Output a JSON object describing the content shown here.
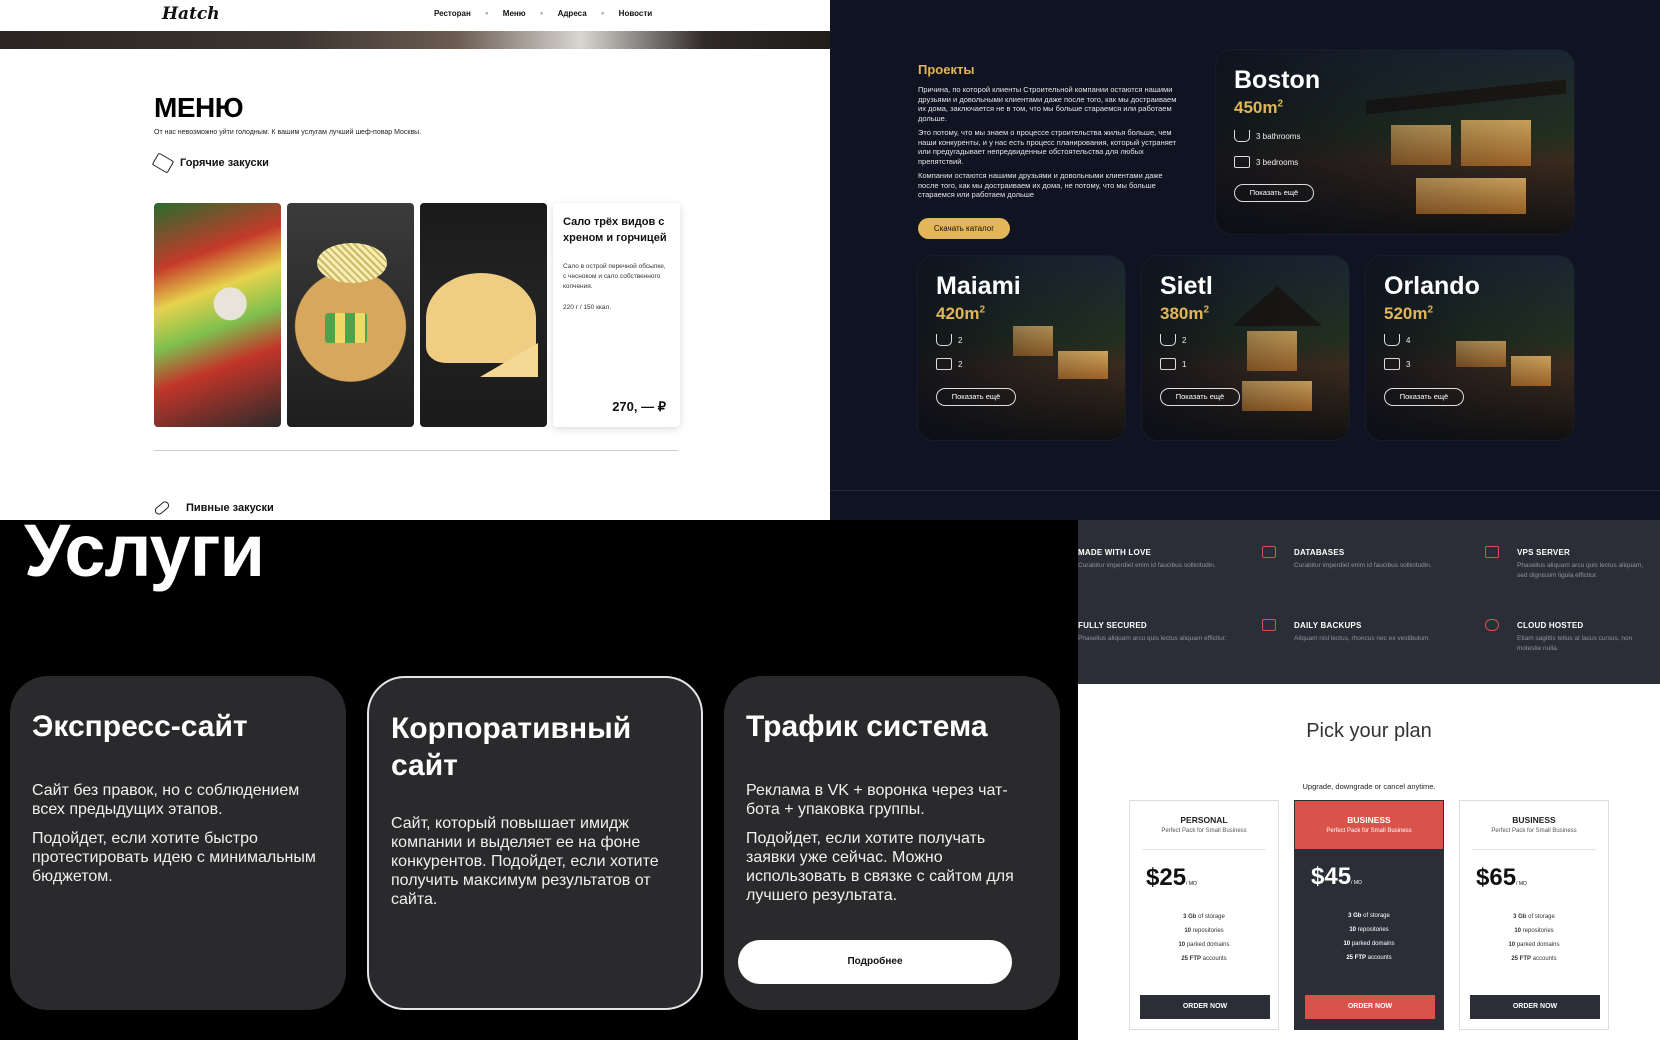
{
  "restaurant": {
    "logo": "Hatch",
    "nav": [
      "Ресторан",
      "Меню",
      "Адреса",
      "Новости"
    ],
    "nav_separator": "•",
    "title": "МЕНЮ",
    "subtitle": "От нас невозможно уйти голодным. К вашим услугам лучший шеф-повар Москвы.",
    "category1": "Горячие закуски",
    "category1_icon": "grill-icon",
    "category2": "Пивные закуски",
    "category2_icon": "sausage-icon",
    "dish": {
      "title": "Сало трёх видов с хреном и горчицей",
      "description": "Сало в острой перечной обсыпке, с чесноком и сало собственного копчения.",
      "kcal": "220 г / 150 ккал.",
      "price": "270, — ₽"
    }
  },
  "projects": {
    "title": "Проекты",
    "paragraphs": [
      "Причина, по которой клиенты Строительной компании остаются нашими друзьями и довольными клиентами даже после того, как мы достраиваем их дома, заключается не в том, что мы больше стараемся или работаем дольше.",
      "Это потому, что мы знаем о процессе строительства жилья больше, чем наши конкуренты, и у нас есть процесс планирования, который устраняет или предугадывает непредвиденные обстоятельства для любых препятствий.",
      "Компании остаются нашими друзьями и довольными клиентами даже после того, как мы достраиваем их дома, не потому, что мы больше стараемся или работаем дольше"
    ],
    "catalog_button": "Скачать каталог",
    "more_label": "Показать ещё",
    "accent": "#e2b659",
    "houses": [
      {
        "name": "Boston",
        "area": "450m",
        "bath": "3 bathrooms",
        "bed": "3 bedrooms"
      },
      {
        "name": "Maiami",
        "area": "420m",
        "bath": "2",
        "bed": "2"
      },
      {
        "name": "Sietl",
        "area": "380m",
        "bath": "2",
        "bed": "1"
      },
      {
        "name": "Orlando",
        "area": "520m",
        "bath": "4",
        "bed": "3"
      }
    ],
    "area_sup": "2"
  },
  "services": {
    "title": "Услуги",
    "cards": [
      {
        "title": "Экспресс-сайт",
        "p1": "Сайт без правок, но с соблюдением всех предыдущих этапов.",
        "p2": "Подойдет, если хотите быстро протестировать идею с минимальным бюджетом."
      },
      {
        "title": "Корпоративный сайт",
        "p1": "Сайт, который повышает имидж компании и выделяет ее на фоне конкурентов. Подойдет, если хотите получить максимум результатов от сайта.",
        "p2": "Подойдет, если хотите получить максимум результатов от сайта."
      },
      {
        "title": "Трафик система",
        "p1": "Реклама в VK + воронка через чат-бота + упаковка группы.",
        "p2": "Подойдет, если хотите получать заявки уже сейчас. Можно использовать в связке с сайтом для лучшего результата.",
        "button": "Подробнее"
      }
    ]
  },
  "hosting": {
    "features": [
      {
        "title": "MADE WITH LOVE",
        "desc": "Curabitur imperdiet enim id faucibus sollicitudin.",
        "icon": "heart-icon"
      },
      {
        "title": "DATABASES",
        "desc": "Curabitur imperdiet enim id faucibus sollicitudin.",
        "icon": "database-icon"
      },
      {
        "title": "VPS SERVER",
        "desc": "Phasellus aliquam arcu quis lectus aliquam, sed dignissim ligula efficitur.",
        "icon": "server-icon"
      },
      {
        "title": "FULLY SECURED",
        "desc": "Phasellus aliquam arcu quis lectus aliquam efficitur.",
        "icon": "shield-icon"
      },
      {
        "title": "DAILY BACKUPS",
        "desc": "Aliquam nisl lectus, rhoncus nec ex vestibulum.",
        "icon": "calendar-icon"
      },
      {
        "title": "CLOUD HOSTED",
        "desc": "Etiam sagittis tellus at lacus cursus, non molestie nulla.",
        "icon": "cloud-icon"
      }
    ],
    "plan_title": "Pick your plan",
    "plan_subtitle": "Upgrade, downgrade or cancel anytime.",
    "accent": "#d9534a",
    "plans": [
      {
        "name": "PERSONAL",
        "desc": "Perfect Pack for Small Business",
        "price": "$25",
        "per": "/ MO",
        "storage": "3 Gb",
        "repos": "10",
        "domains": "10",
        "ftp": "25 FTP",
        "button": "ORDER NOW"
      },
      {
        "name": "BUSINESS",
        "desc": "Perfect Pack for Small Business",
        "price": "$45",
        "per": "/ MO",
        "storage": "3 Gb",
        "repos": "10",
        "domains": "10",
        "ftp": "25 FTP",
        "button": "ORDER NOW"
      },
      {
        "name": "BUSINESS",
        "desc": "Perfect Pack for Small Business",
        "price": "$65",
        "per": "/ MO",
        "storage": "3 Gb",
        "repos": "10",
        "domains": "10",
        "ftp": "25 FTP",
        "button": "ORDER NOW"
      }
    ],
    "labels": {
      "storage": "of storage",
      "repos": "repositories",
      "domains": "parked domains",
      "ftp": "accounts"
    }
  }
}
